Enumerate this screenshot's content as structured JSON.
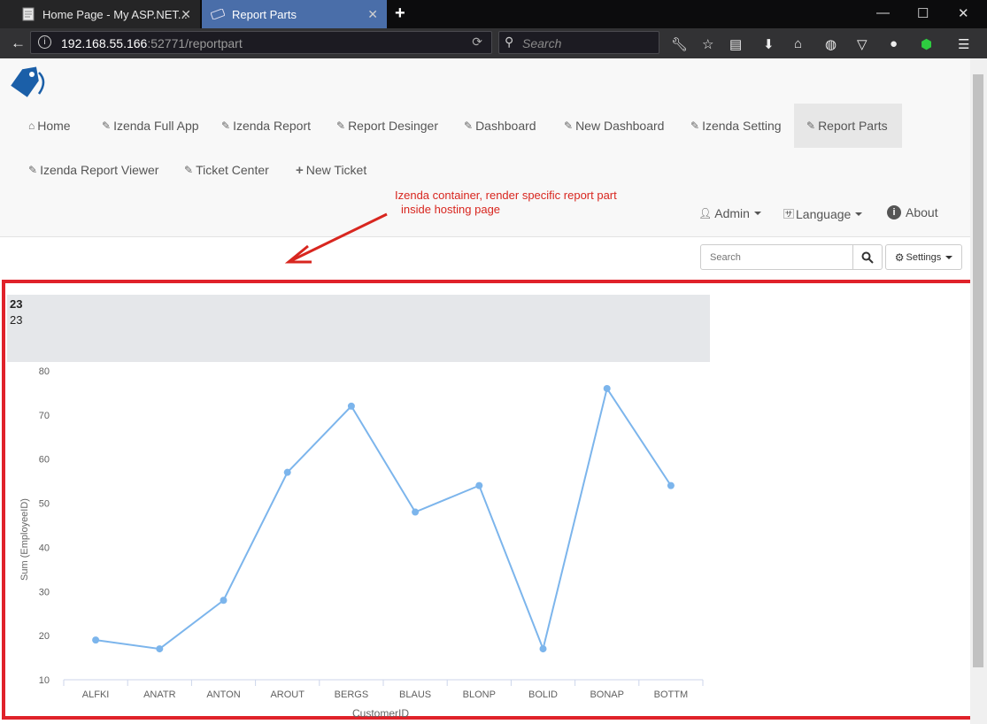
{
  "browser": {
    "tabs": [
      {
        "title": "Home Page - My ASP.NET...",
        "icon": "page-icon"
      },
      {
        "title": "Report Parts",
        "icon": "ticket-icon",
        "active": true
      }
    ],
    "url_host": "192.168.55.166",
    "url_rest": ":52771/reportpart",
    "search_placeholder": "Search"
  },
  "nav": {
    "items": [
      {
        "label": "Home",
        "icon": "home-icon"
      },
      {
        "label": "Izenda Full App",
        "icon": "ticket-icon"
      },
      {
        "label": "Izenda Report",
        "icon": "ticket-icon"
      },
      {
        "label": "Report Desinger",
        "icon": "ticket-icon"
      },
      {
        "label": "Dashboard",
        "icon": "ticket-icon"
      },
      {
        "label": "New Dashboard",
        "icon": "ticket-icon"
      },
      {
        "label": "Izenda Setting",
        "icon": "ticket-icon"
      },
      {
        "label": "Report Parts",
        "icon": "ticket-icon",
        "active": true
      },
      {
        "label": "Izenda Report Viewer",
        "icon": "ticket-icon"
      },
      {
        "label": "Ticket Center",
        "icon": "ticket-icon"
      },
      {
        "label": "New Ticket",
        "icon": "plus-icon"
      }
    ],
    "admin_label": "Admin",
    "language_label": "Language",
    "about_label": "About"
  },
  "annotation": {
    "line1": "Izenda container, render specific report part",
    "line2": "inside hosting page"
  },
  "toolbar": {
    "search_placeholder": "Search",
    "settings_label": "Settings"
  },
  "report_part": {
    "header_bold": "23",
    "header_value": "23"
  },
  "chart_data": {
    "type": "line",
    "categories": [
      "ALFKI",
      "ANATR",
      "ANTON",
      "AROUT",
      "BERGS",
      "BLAUS",
      "BLONP",
      "BOLID",
      "BONAP",
      "BOTTM"
    ],
    "values": [
      19,
      17,
      28,
      57,
      72,
      48,
      54,
      17,
      76,
      54
    ],
    "xlabel": "CustomerID",
    "ylabel": "Sum (EmployeeID)",
    "ylim": [
      10,
      80
    ],
    "yticks": [
      10,
      20,
      30,
      40,
      50,
      60,
      70,
      80
    ],
    "color": "#7cb5ec",
    "grid": false
  },
  "colors": {
    "accent_red": "#e0222a",
    "active_tab": "#4a6ea9",
    "line": "#7cb5ec"
  }
}
